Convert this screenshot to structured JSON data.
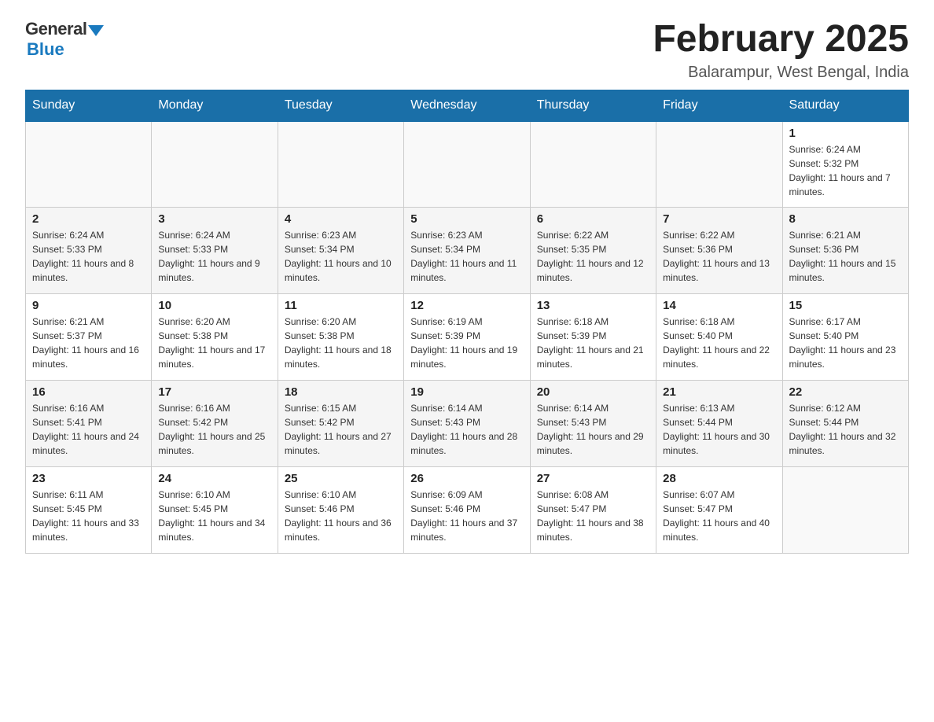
{
  "header": {
    "logo_general": "General",
    "logo_blue": "Blue",
    "month_title": "February 2025",
    "location": "Balarampur, West Bengal, India"
  },
  "weekdays": [
    "Sunday",
    "Monday",
    "Tuesday",
    "Wednesday",
    "Thursday",
    "Friday",
    "Saturday"
  ],
  "weeks": [
    [
      {
        "day": "",
        "info": ""
      },
      {
        "day": "",
        "info": ""
      },
      {
        "day": "",
        "info": ""
      },
      {
        "day": "",
        "info": ""
      },
      {
        "day": "",
        "info": ""
      },
      {
        "day": "",
        "info": ""
      },
      {
        "day": "1",
        "info": "Sunrise: 6:24 AM\nSunset: 5:32 PM\nDaylight: 11 hours and 7 minutes."
      }
    ],
    [
      {
        "day": "2",
        "info": "Sunrise: 6:24 AM\nSunset: 5:33 PM\nDaylight: 11 hours and 8 minutes."
      },
      {
        "day": "3",
        "info": "Sunrise: 6:24 AM\nSunset: 5:33 PM\nDaylight: 11 hours and 9 minutes."
      },
      {
        "day": "4",
        "info": "Sunrise: 6:23 AM\nSunset: 5:34 PM\nDaylight: 11 hours and 10 minutes."
      },
      {
        "day": "5",
        "info": "Sunrise: 6:23 AM\nSunset: 5:34 PM\nDaylight: 11 hours and 11 minutes."
      },
      {
        "day": "6",
        "info": "Sunrise: 6:22 AM\nSunset: 5:35 PM\nDaylight: 11 hours and 12 minutes."
      },
      {
        "day": "7",
        "info": "Sunrise: 6:22 AM\nSunset: 5:36 PM\nDaylight: 11 hours and 13 minutes."
      },
      {
        "day": "8",
        "info": "Sunrise: 6:21 AM\nSunset: 5:36 PM\nDaylight: 11 hours and 15 minutes."
      }
    ],
    [
      {
        "day": "9",
        "info": "Sunrise: 6:21 AM\nSunset: 5:37 PM\nDaylight: 11 hours and 16 minutes."
      },
      {
        "day": "10",
        "info": "Sunrise: 6:20 AM\nSunset: 5:38 PM\nDaylight: 11 hours and 17 minutes."
      },
      {
        "day": "11",
        "info": "Sunrise: 6:20 AM\nSunset: 5:38 PM\nDaylight: 11 hours and 18 minutes."
      },
      {
        "day": "12",
        "info": "Sunrise: 6:19 AM\nSunset: 5:39 PM\nDaylight: 11 hours and 19 minutes."
      },
      {
        "day": "13",
        "info": "Sunrise: 6:18 AM\nSunset: 5:39 PM\nDaylight: 11 hours and 21 minutes."
      },
      {
        "day": "14",
        "info": "Sunrise: 6:18 AM\nSunset: 5:40 PM\nDaylight: 11 hours and 22 minutes."
      },
      {
        "day": "15",
        "info": "Sunrise: 6:17 AM\nSunset: 5:40 PM\nDaylight: 11 hours and 23 minutes."
      }
    ],
    [
      {
        "day": "16",
        "info": "Sunrise: 6:16 AM\nSunset: 5:41 PM\nDaylight: 11 hours and 24 minutes."
      },
      {
        "day": "17",
        "info": "Sunrise: 6:16 AM\nSunset: 5:42 PM\nDaylight: 11 hours and 25 minutes."
      },
      {
        "day": "18",
        "info": "Sunrise: 6:15 AM\nSunset: 5:42 PM\nDaylight: 11 hours and 27 minutes."
      },
      {
        "day": "19",
        "info": "Sunrise: 6:14 AM\nSunset: 5:43 PM\nDaylight: 11 hours and 28 minutes."
      },
      {
        "day": "20",
        "info": "Sunrise: 6:14 AM\nSunset: 5:43 PM\nDaylight: 11 hours and 29 minutes."
      },
      {
        "day": "21",
        "info": "Sunrise: 6:13 AM\nSunset: 5:44 PM\nDaylight: 11 hours and 30 minutes."
      },
      {
        "day": "22",
        "info": "Sunrise: 6:12 AM\nSunset: 5:44 PM\nDaylight: 11 hours and 32 minutes."
      }
    ],
    [
      {
        "day": "23",
        "info": "Sunrise: 6:11 AM\nSunset: 5:45 PM\nDaylight: 11 hours and 33 minutes."
      },
      {
        "day": "24",
        "info": "Sunrise: 6:10 AM\nSunset: 5:45 PM\nDaylight: 11 hours and 34 minutes."
      },
      {
        "day": "25",
        "info": "Sunrise: 6:10 AM\nSunset: 5:46 PM\nDaylight: 11 hours and 36 minutes."
      },
      {
        "day": "26",
        "info": "Sunrise: 6:09 AM\nSunset: 5:46 PM\nDaylight: 11 hours and 37 minutes."
      },
      {
        "day": "27",
        "info": "Sunrise: 6:08 AM\nSunset: 5:47 PM\nDaylight: 11 hours and 38 minutes."
      },
      {
        "day": "28",
        "info": "Sunrise: 6:07 AM\nSunset: 5:47 PM\nDaylight: 11 hours and 40 minutes."
      },
      {
        "day": "",
        "info": ""
      }
    ]
  ]
}
